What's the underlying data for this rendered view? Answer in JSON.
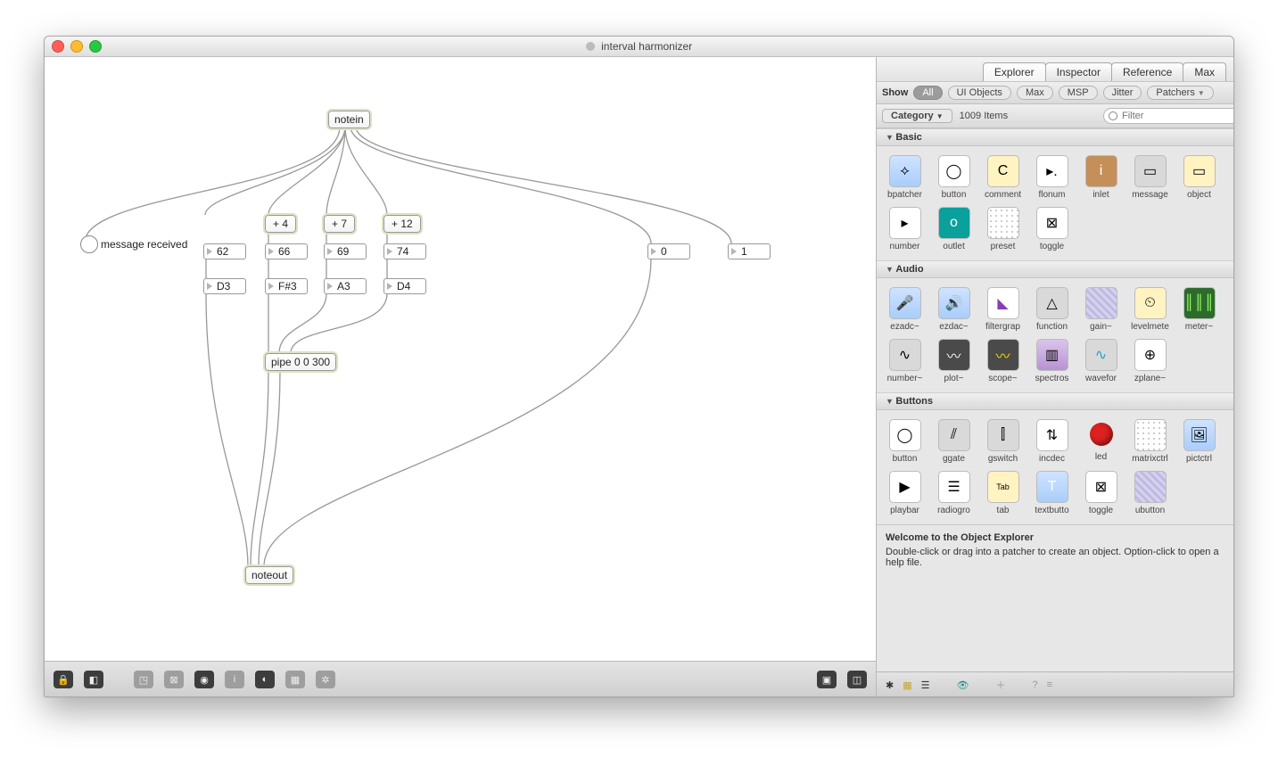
{
  "window": {
    "title": "interval harmonmizer",
    "title_display": "interval harmonizer"
  },
  "patch": {
    "objects": {
      "notein": "notein",
      "plus4": "+ 4",
      "plus7": "+ 7",
      "plus12": "+ 12",
      "pipe": "pipe 0 0 300",
      "noteout": "noteout"
    },
    "numbers": {
      "n0": "62",
      "n1": "66",
      "n2": "69",
      "n3": "74",
      "note0": "D3",
      "note1": "F#3",
      "note2": "A3",
      "note3": "D4",
      "vel": "0",
      "extra": "1"
    },
    "comment": "message received"
  },
  "side": {
    "tabs": [
      "Explorer",
      "Inspector",
      "Reference",
      "Max"
    ],
    "active_tab": "Explorer",
    "show_label": "Show",
    "show_filters": [
      "All",
      "UI Objects",
      "Max",
      "MSP",
      "Jitter",
      "Patchers"
    ],
    "active_show": "All",
    "category_label": "Category",
    "item_count": "1009 Items",
    "search_placeholder": "Filter",
    "sections": {
      "basic": {
        "title": "Basic",
        "items": [
          "bpatcher",
          "button",
          "comment",
          "flonum",
          "inlet",
          "message",
          "object",
          "number",
          "outlet",
          "preset",
          "toggle"
        ]
      },
      "audio": {
        "title": "Audio",
        "items": [
          "ezadc~",
          "ezdac~",
          "filtergrap",
          "function",
          "gain~",
          "levelmete",
          "meter~",
          "number~",
          "plot~",
          "scope~",
          "spectros",
          "wavefor",
          "zplane~"
        ]
      },
      "buttons": {
        "title": "Buttons",
        "items": [
          "button",
          "ggate",
          "gswitch",
          "incdec",
          "led",
          "matrixctrl",
          "pictctrl",
          "playbar",
          "radiogro",
          "tab",
          "textbutto",
          "toggle",
          "ubutton"
        ]
      }
    },
    "info_title": "Welcome to the Object Explorer",
    "info_body": "Double-click or drag into a patcher to create an object. Option-click to open a help file."
  }
}
